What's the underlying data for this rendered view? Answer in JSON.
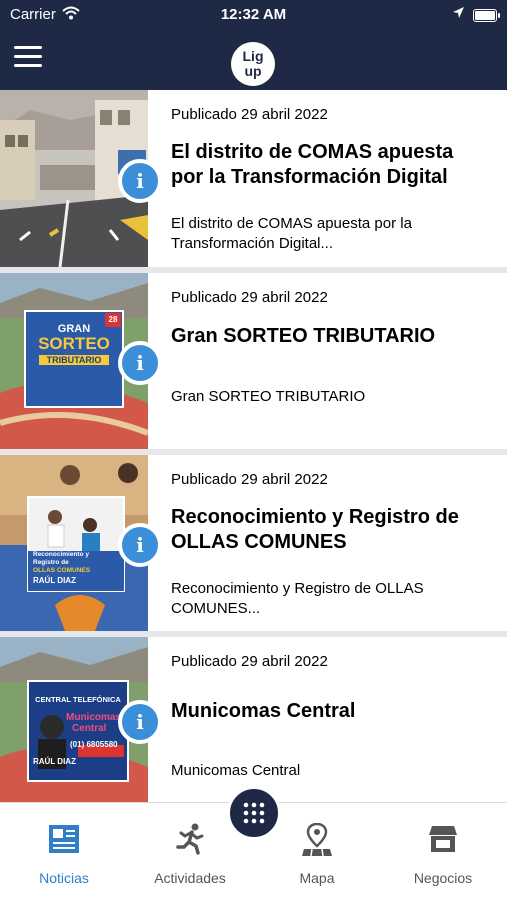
{
  "status_bar": {
    "carrier": "Carrier",
    "time": "12:32 AM"
  },
  "navbar": {
    "logo_line1": "Lig",
    "logo_line2": "up"
  },
  "feed": {
    "items": [
      {
        "date": "Publicado 29 abril 2022",
        "title": "El distrito de COMAS apuesta por la Transformación Digital",
        "summary": "El distrito de COMAS apuesta por la Transformación Digital..."
      },
      {
        "date": "Publicado 29 abril 2022",
        "title": "Gran SORTEO TRIBUTARIO",
        "summary": "Gran SORTEO TRIBUTARIO",
        "poster": {
          "line1": "GRAN",
          "line2": "SORTEO",
          "line3": "TRIBUTARIO",
          "date_badge": "28"
        }
      },
      {
        "date": "Publicado 29 abril 2022",
        "title": "Reconocimiento y Registro de OLLAS COMUNES",
        "summary": "Reconocimiento y Registro de OLLAS COMUNES...",
        "poster": {
          "line1": "Reconocimiento y",
          "line2": "Registro de",
          "line3": "OLLAS COMUNES",
          "name": "RAÚL DIAZ"
        }
      },
      {
        "date": "Publicado 29 abril 2022",
        "title": "Municomas Central",
        "summary": "Municomas Central",
        "poster": {
          "header": "CENTRAL TELEFÓNICA",
          "line1": "Municomas",
          "line2": "Central",
          "phone": "(01) 6805580",
          "name": "RAÚL DIAZ"
        }
      }
    ]
  },
  "tabbar": {
    "tabs": [
      {
        "label": "Noticias",
        "icon": "newspaper-icon",
        "active": true
      },
      {
        "label": "Actividades",
        "icon": "running-person-icon",
        "active": false
      },
      {
        "label": "Mapa",
        "icon": "map-pin-icon",
        "active": false
      },
      {
        "label": "Negocios",
        "icon": "store-icon",
        "active": false
      }
    ]
  },
  "colors": {
    "header": "#1e2a45",
    "accent": "#2f7fc8",
    "info_badge": "#3b8fd9",
    "divider": "#e6e7ea"
  }
}
